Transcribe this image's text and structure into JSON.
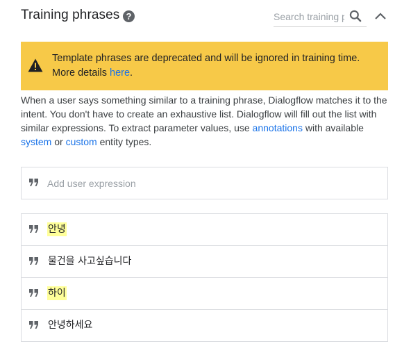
{
  "header": {
    "title": "Training phrases",
    "help_icon": "help-circle-icon",
    "search": {
      "placeholder": "Search training p",
      "value": "",
      "icon": "search-icon"
    },
    "collapse_icon": "chevron-up-icon"
  },
  "warning": {
    "icon": "warning-triangle-icon",
    "text_before": "Template phrases are deprecated and will be ignored in training time. More details ",
    "link": "here",
    "text_after": ".",
    "background": "#f7c948"
  },
  "description": {
    "part1": "When a user says something similar to a training phrase, Dialogflow matches it to the intent. You don't have to create an exhaustive list. Dialogflow will fill out the list with similar expressions. To extract parameter values, use ",
    "link_annotations": "annotations",
    "part2": " with available ",
    "link_system": "system",
    "part3": " or ",
    "link_custom": "custom",
    "part4": " entity types."
  },
  "add_expression": {
    "placeholder": "Add user expression",
    "icon": "quote-icon"
  },
  "phrases": [
    {
      "text": "안녕",
      "highlighted": true
    },
    {
      "text": "물건을 사고싶습니다",
      "highlighted": false
    },
    {
      "text": "하이",
      "highlighted": true
    },
    {
      "text": "안녕하세요",
      "highlighted": false
    }
  ],
  "colors": {
    "link": "#1a73e8",
    "highlight": "#ffff99",
    "border": "#dadce0"
  }
}
